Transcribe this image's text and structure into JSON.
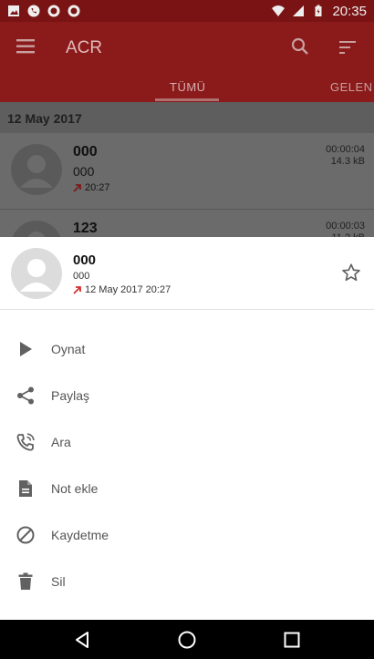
{
  "status_bar": {
    "time": "20:35"
  },
  "app_bar": {
    "title": "ACR",
    "tabs": [
      "TÜMÜ",
      "GELEN"
    ]
  },
  "list": {
    "date_header": "12 May 2017",
    "items": [
      {
        "name": "000",
        "number": "000",
        "time": "20:27",
        "duration": "00:00:04",
        "size": "14.3 kB"
      },
      {
        "name": "123",
        "duration": "00:00:03",
        "size": "11.2 kB"
      }
    ]
  },
  "sheet": {
    "name": "000",
    "number": "000",
    "datetime": "12 May 2017 20:27",
    "actions": [
      {
        "label": "Oynat",
        "icon": "play-icon"
      },
      {
        "label": "Paylaş",
        "icon": "share-icon"
      },
      {
        "label": "Ara",
        "icon": "phone-icon"
      },
      {
        "label": "Not ekle",
        "icon": "note-icon"
      },
      {
        "label": "Kaydetme",
        "icon": "block-icon"
      },
      {
        "label": "Sil",
        "icon": "trash-icon"
      }
    ]
  },
  "colors": {
    "appbar_dim": "#8b1a1a",
    "statusbar_dim": "#7a1414",
    "outgoing_arrow": "#d32f2f",
    "icon_gray": "#616161"
  }
}
